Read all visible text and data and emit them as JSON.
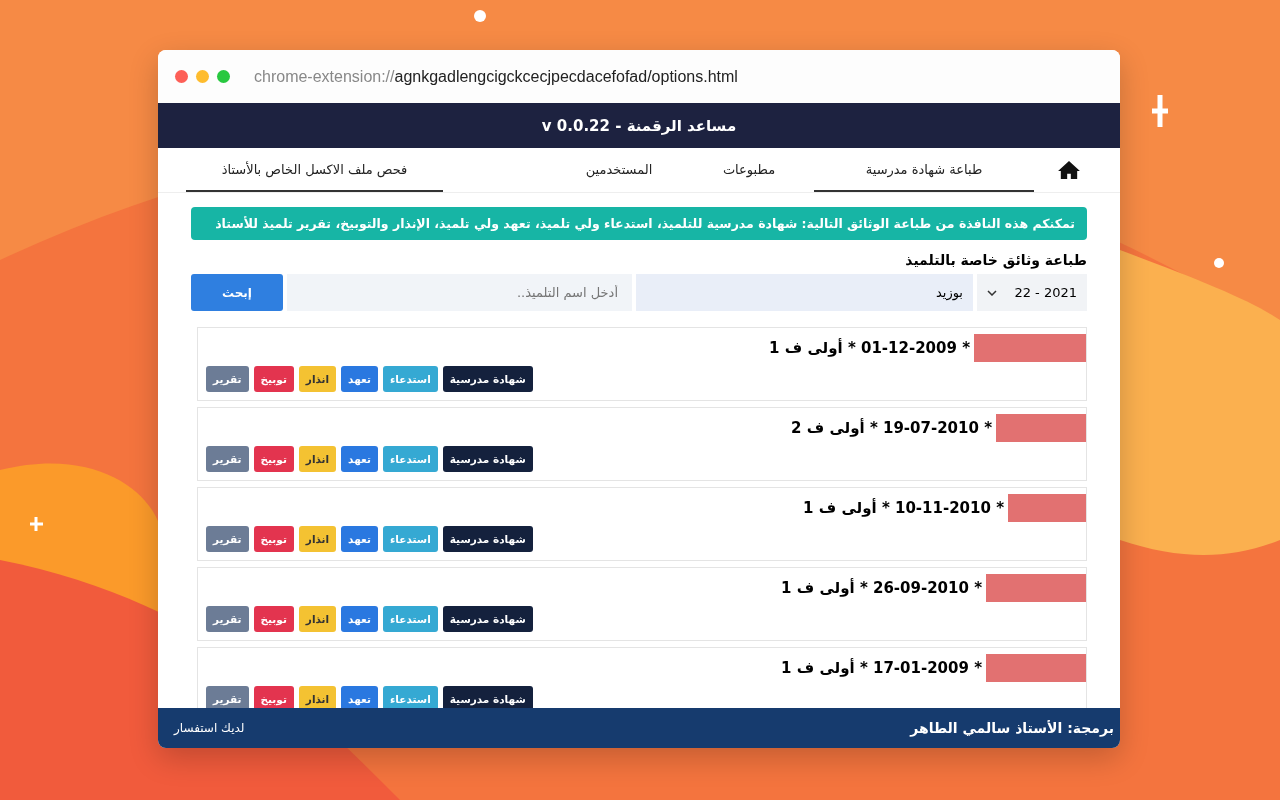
{
  "window": {
    "url_scheme": "chrome-extension://",
    "url_rest": "agnkgadlengcigckcecjpecdacefofad/options.html"
  },
  "header": {
    "title": "مساعد الرقمنة - v 0.0.22"
  },
  "tabs": [
    {
      "label": "طباعة شهادة مدرسية",
      "selected": true
    },
    {
      "label": "مطبوعات",
      "selected": false
    },
    {
      "label": "المستخدمين",
      "selected": false
    },
    {
      "label": "فحص ملف الاكسل الخاص بالأستاذ",
      "selected": true
    }
  ],
  "notice": "تمكنكم هذه النافذة من طباعة الوثائق التالية: شهادة مدرسية للتلميذ، استدعاء ولي تلميذ، تعهد ولي تلميذ، الإنذار والتوبيخ، تقرير تلميذ للأستاذ",
  "section_title": "طباعة وثائق خاصة بالتلميذ",
  "search": {
    "year": "2021 - 22",
    "school": "بوزيد",
    "placeholder": "أدخل اسم التلميذ..",
    "button": "إبحث"
  },
  "students": [
    {
      "line": "* 01-12-2009 * أولى ف 1",
      "actions": [
        {
          "label": "شهادة مدرسية",
          "color": "#14213d"
        },
        {
          "label": "استدعاء",
          "color": "#35a9d3"
        },
        {
          "label": "تعهد",
          "color": "#2a78e0"
        },
        {
          "label": "انذار",
          "color": "#f4c232"
        },
        {
          "label": "توبيخ",
          "color": "#e3344f"
        },
        {
          "label": "تقرير",
          "color": "#6c7c96"
        }
      ]
    },
    {
      "line": "* 19-07-2010 * أولى ف 2",
      "actions": [
        {
          "label": "شهادة مدرسية",
          "color": "#14213d"
        },
        {
          "label": "استدعاء",
          "color": "#35a9d3"
        },
        {
          "label": "تعهد",
          "color": "#2a78e0"
        },
        {
          "label": "انذار",
          "color": "#f4c232"
        },
        {
          "label": "توبيخ",
          "color": "#e3344f"
        },
        {
          "label": "تقرير",
          "color": "#6c7c96"
        }
      ]
    },
    {
      "line": "* 10-11-2010 * أولى ف 1",
      "actions": [
        {
          "label": "شهادة مدرسية",
          "color": "#14213d"
        },
        {
          "label": "استدعاء",
          "color": "#35a9d3"
        },
        {
          "label": "تعهد",
          "color": "#2a78e0"
        },
        {
          "label": "انذار",
          "color": "#f4c232"
        },
        {
          "label": "توبيخ",
          "color": "#e3344f"
        },
        {
          "label": "تقرير",
          "color": "#6c7c96"
        }
      ]
    },
    {
      "line": "* 26-09-2010 * أولى ف 1",
      "actions": [
        {
          "label": "شهادة مدرسية",
          "color": "#14213d"
        },
        {
          "label": "استدعاء",
          "color": "#35a9d3"
        },
        {
          "label": "تعهد",
          "color": "#2a78e0"
        },
        {
          "label": "انذار",
          "color": "#f4c232"
        },
        {
          "label": "توبيخ",
          "color": "#e3344f"
        },
        {
          "label": "تقرير",
          "color": "#6c7c96"
        }
      ]
    },
    {
      "line": "* 17-01-2009 * أولى ف 1",
      "actions": [
        {
          "label": "شهادة مدرسية",
          "color": "#14213d"
        },
        {
          "label": "استدعاء",
          "color": "#35a9d3"
        },
        {
          "label": "تعهد",
          "color": "#2a78e0"
        },
        {
          "label": "انذار",
          "color": "#f4c232"
        },
        {
          "label": "توبيخ",
          "color": "#e3344f"
        },
        {
          "label": "تقرير",
          "color": "#6c7c96"
        }
      ]
    }
  ],
  "footer": {
    "credit": "برمجة: الأستاذ سالمي الطاهر",
    "link": "لديك استفسار"
  }
}
